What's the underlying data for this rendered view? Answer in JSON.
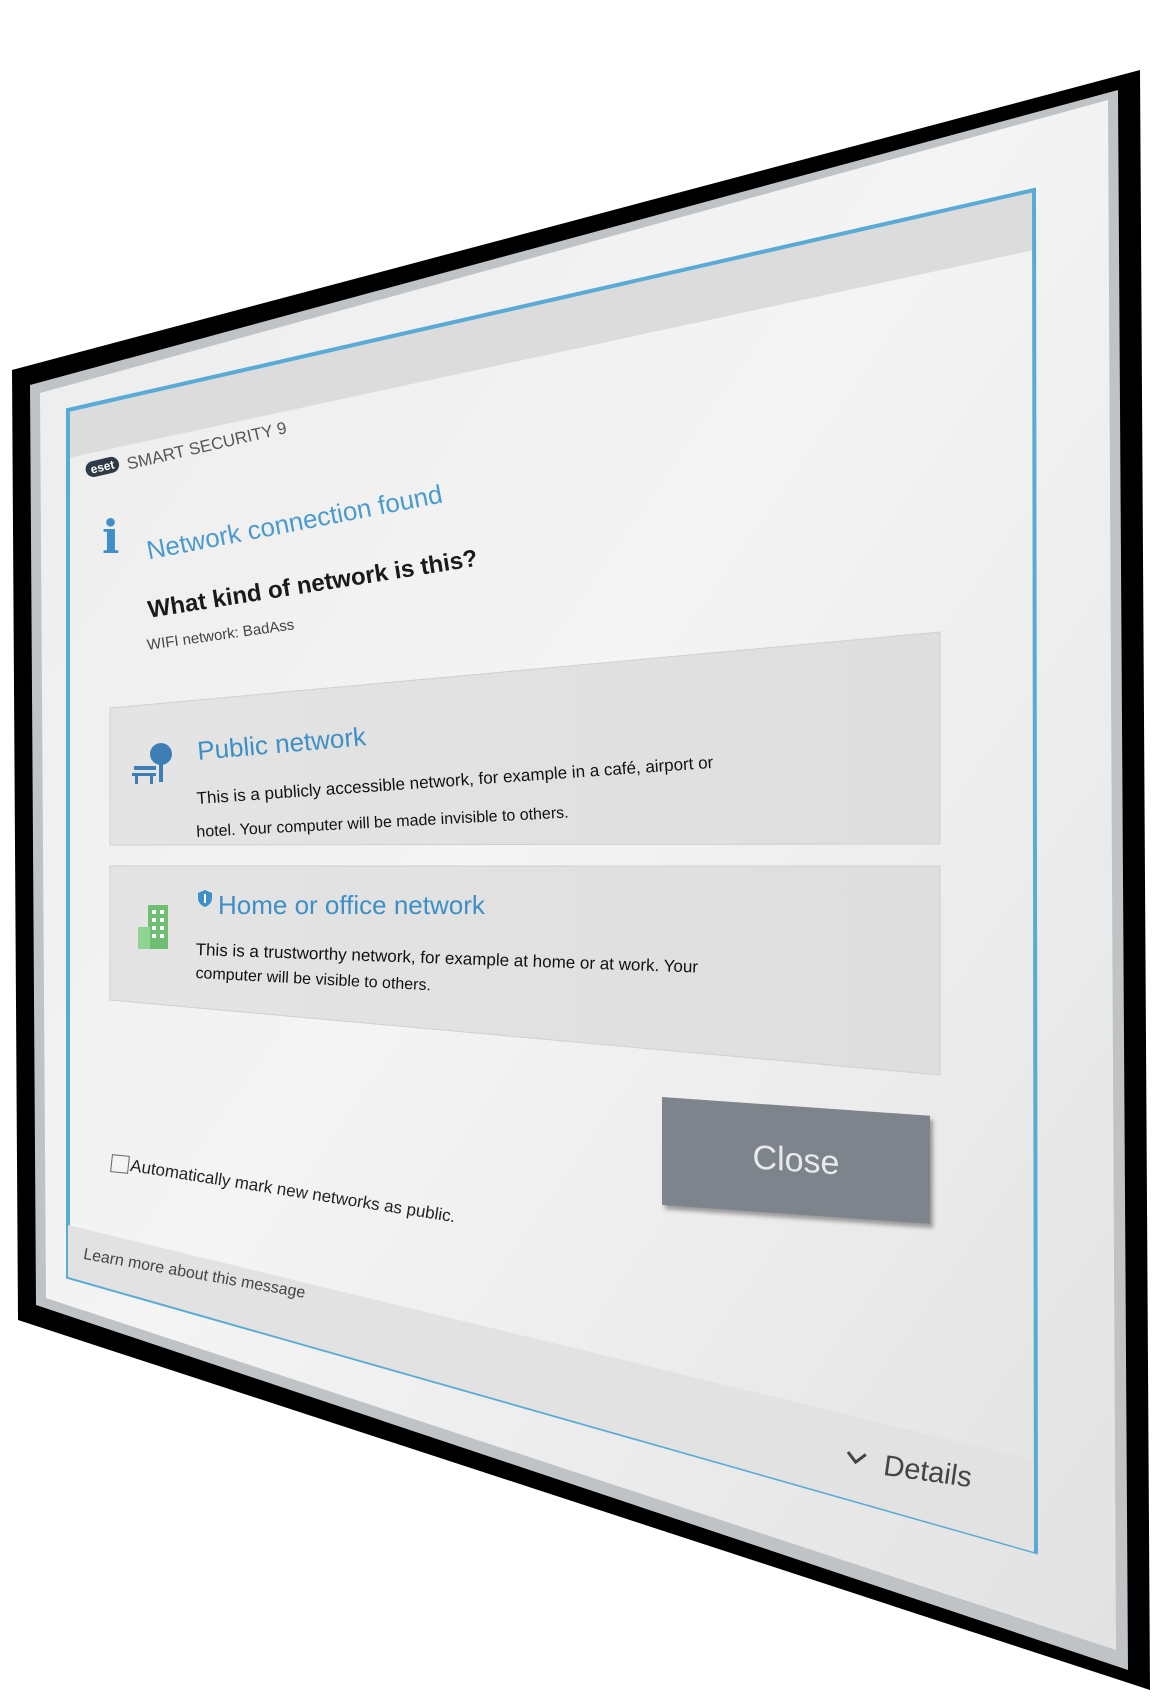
{
  "app": {
    "logo_text": "eset",
    "brand": "SMART SECURITY 9"
  },
  "message": {
    "title": "Network connection found",
    "question": "What kind of network is this?",
    "network_label": "WIFI network: BadAss"
  },
  "options": [
    {
      "title": "Public network",
      "desc_line1": "This is a publicly accessible network, for example in a café, airport or",
      "desc_line2": "hotel. Your computer will be made invisible to others.",
      "icon": "park-bench-icon"
    },
    {
      "title": "Home or office network",
      "desc_line1": "This is a trustworthy network, for example at home or at work. Your",
      "desc_line2": "computer will be visible to others.",
      "icon": "building-icon",
      "badge_icon": "shield-icon"
    }
  ],
  "checkbox": {
    "label": "Automatically mark new networks as public.",
    "checked": false
  },
  "buttons": {
    "close": "Close"
  },
  "footer": {
    "learn_more": "Learn more about this message",
    "details": "Details"
  },
  "colors": {
    "accent": "#3d8fc6",
    "frame_border": "#5aaad6",
    "button": "#7e848b",
    "bezel": "#000000"
  }
}
